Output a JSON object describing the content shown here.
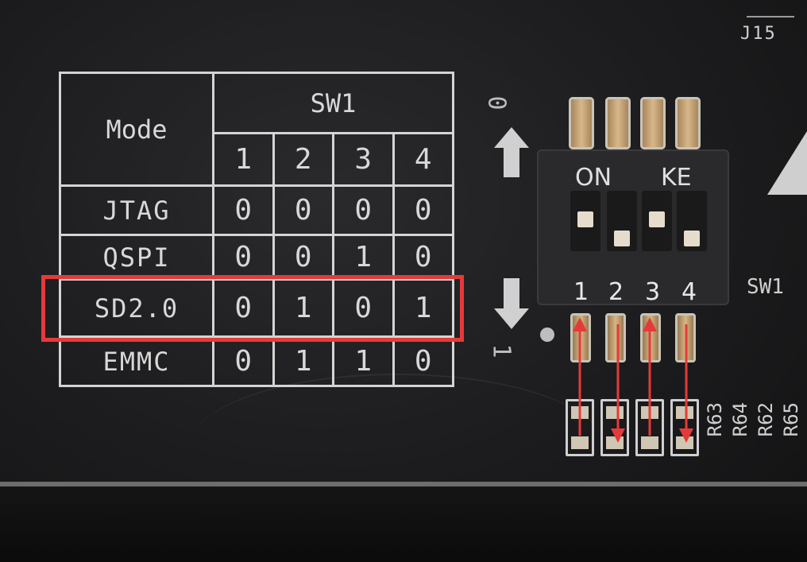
{
  "board": {
    "connector_label": "J15",
    "switch_label": "SW1"
  },
  "table": {
    "mode_header": "Mode",
    "switch_header": "SW1",
    "switch_numbers": [
      "1",
      "2",
      "3",
      "4"
    ],
    "rows": [
      {
        "mode": "JTAG",
        "values": [
          "0",
          "0",
          "0",
          "0"
        ]
      },
      {
        "mode": "QSPI",
        "values": [
          "0",
          "0",
          "1",
          "0"
        ]
      },
      {
        "mode": "SD2.0",
        "values": [
          "0",
          "1",
          "0",
          "1"
        ]
      },
      {
        "mode": "EMMC",
        "values": [
          "0",
          "1",
          "1",
          "0"
        ]
      }
    ],
    "highlighted_row": "SD2.0",
    "highlight_color": "#e53a3a"
  },
  "direction": {
    "up_value": "0",
    "down_value": "1"
  },
  "dip_switch": {
    "on_label": "ON",
    "brand_label": "KE",
    "numbers": [
      "1",
      "2",
      "3",
      "4"
    ],
    "positions": [
      "0",
      "1",
      "0",
      "1"
    ]
  },
  "resistors": [
    "R63",
    "R64",
    "R62",
    "R65"
  ],
  "annotation": {
    "arrow_color": "#e53a3a"
  }
}
